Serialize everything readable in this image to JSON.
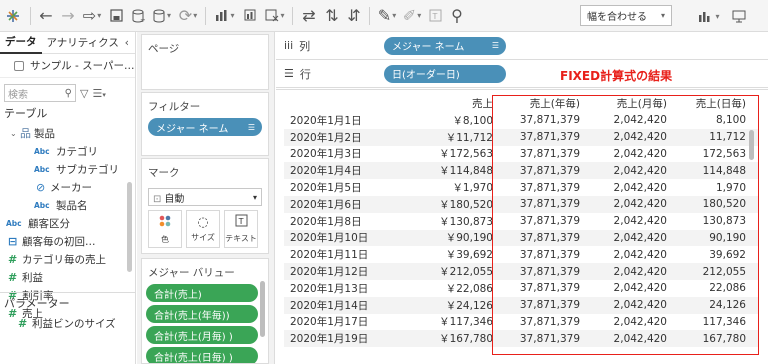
{
  "toolbar": {
    "fit_label": "幅を合わせる"
  },
  "datapane": {
    "tabs": [
      "データ",
      "アナリティクス"
    ],
    "datasource": "サンプル - スーパー…",
    "search_placeholder": "検索",
    "tables_heading": "テーブル",
    "fields": [
      {
        "kind": "folder",
        "label": "製品",
        "caret": true
      },
      {
        "kind": "abc",
        "label": "カテゴリ"
      },
      {
        "kind": "abc",
        "label": "サブカテゴリ"
      },
      {
        "kind": "clip",
        "label": "メーカー"
      },
      {
        "kind": "abc",
        "label": "製品名"
      },
      {
        "kind": "abc",
        "label": "顧客区分"
      },
      {
        "kind": "date",
        "label": "顧客毎の初回…"
      },
      {
        "kind": "calc",
        "label": "カテゴリ毎の売上"
      },
      {
        "kind": "measure",
        "label": "利益"
      },
      {
        "kind": "measure",
        "label": "割引率"
      },
      {
        "kind": "measure",
        "label": "売上"
      }
    ],
    "params_heading": "パラメーター",
    "param_item": "利益ビンのサイズ"
  },
  "cards": {
    "pages_title": "ページ",
    "filters_title": "フィルター",
    "filter_pill": "メジャー ネーム",
    "marks_title": "マーク",
    "mark_type": "自動",
    "mark_buttons": [
      "色",
      "サイズ",
      "テキスト"
    ],
    "measure_values_title": "メジャー バリュー",
    "measure_pills": [
      "合計(売上)",
      "合計(売上(年毎))",
      "合計(売上(月毎) )",
      "合計(売上(日毎) )"
    ]
  },
  "shelves": {
    "columns_label": "列",
    "columns_pill": "メジャー ネーム",
    "rows_label": "行",
    "rows_pill": "日(オーダー日)"
  },
  "annotation": "FIXED計算式の結果",
  "table": {
    "headers": [
      "",
      "売上",
      "売上(年毎)",
      "売上(月毎)",
      "売上(日毎)"
    ],
    "rows": [
      [
        "2020年1月1日",
        "￥8,100",
        "37,871,379",
        "2,042,420",
        "8,100"
      ],
      [
        "2020年1月2日",
        "￥11,712",
        "37,871,379",
        "2,042,420",
        "11,712"
      ],
      [
        "2020年1月3日",
        "￥172,563",
        "37,871,379",
        "2,042,420",
        "172,563"
      ],
      [
        "2020年1月4日",
        "￥114,848",
        "37,871,379",
        "2,042,420",
        "114,848"
      ],
      [
        "2020年1月5日",
        "￥1,970",
        "37,871,379",
        "2,042,420",
        "1,970"
      ],
      [
        "2020年1月6日",
        "￥180,520",
        "37,871,379",
        "2,042,420",
        "180,520"
      ],
      [
        "2020年1月8日",
        "￥130,873",
        "37,871,379",
        "2,042,420",
        "130,873"
      ],
      [
        "2020年1月10日",
        "￥90,190",
        "37,871,379",
        "2,042,420",
        "90,190"
      ],
      [
        "2020年1月11日",
        "￥39,692",
        "37,871,379",
        "2,042,420",
        "39,692"
      ],
      [
        "2020年1月12日",
        "￥212,055",
        "37,871,379",
        "2,042,420",
        "212,055"
      ],
      [
        "2020年1月13日",
        "￥22,086",
        "37,871,379",
        "2,042,420",
        "22,086"
      ],
      [
        "2020年1月14日",
        "￥24,126",
        "37,871,379",
        "2,042,420",
        "24,126"
      ],
      [
        "2020年1月17日",
        "￥117,346",
        "37,871,379",
        "2,042,420",
        "117,346"
      ],
      [
        "2020年1月19日",
        "￥167,780",
        "37,871,379",
        "2,042,420",
        "167,780"
      ]
    ]
  },
  "colors": {
    "accent_blue": "#4a90b8",
    "measure_green": "#3aa556",
    "annotation_red": "#e8201a"
  }
}
